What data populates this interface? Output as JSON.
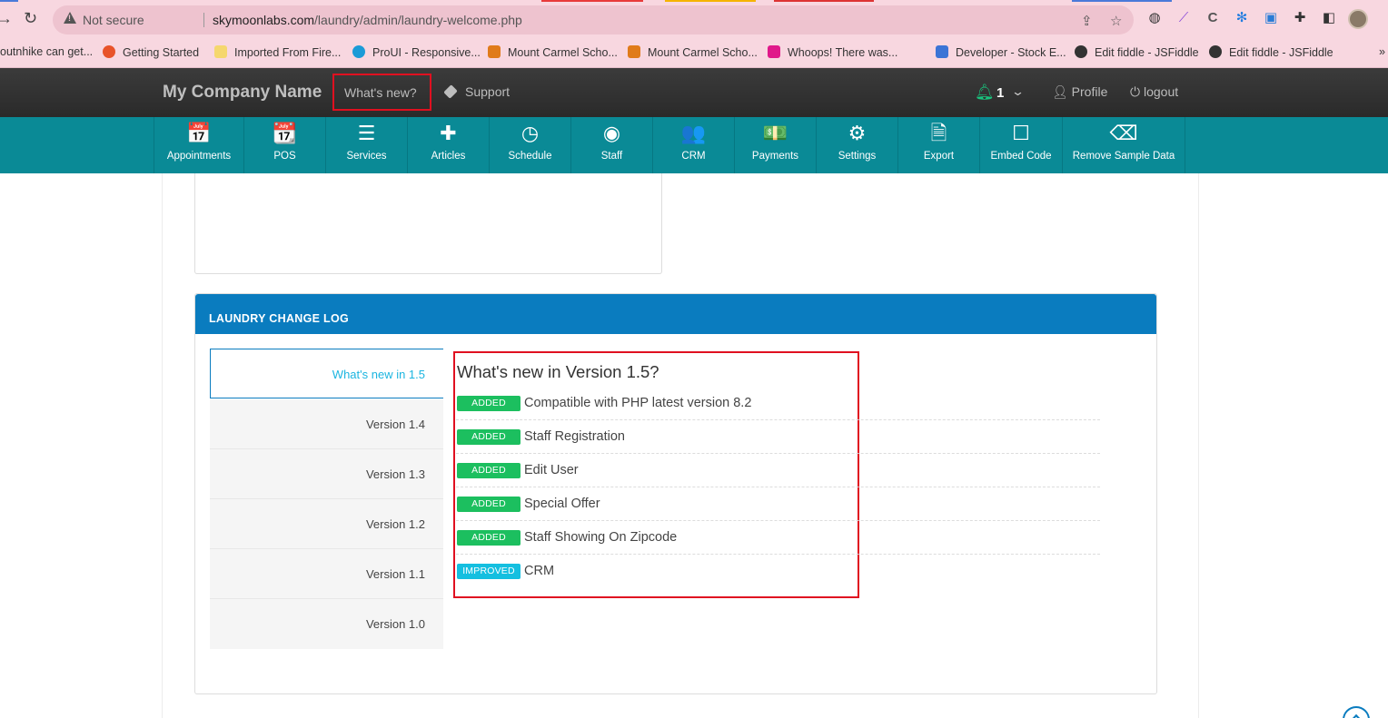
{
  "browser": {
    "security_label": "Not secure",
    "url_host": "skymoonlabs.com",
    "url_path": "/laundry/admin/laundry-welcome.php",
    "bookmarks": [
      {
        "label": "outnhike can get...",
        "color": "#f8d7e0"
      },
      {
        "label": "Getting Started",
        "color": "#e8532a"
      },
      {
        "label": "Imported From Fire...",
        "color": "#f5d76e"
      },
      {
        "label": "ProUI - Responsive...",
        "color": "#1b9bd7"
      },
      {
        "label": "Mount Carmel Scho...",
        "color": "#e07b1a"
      },
      {
        "label": "Mount Carmel Scho...",
        "color": "#e07b1a"
      },
      {
        "label": "Whoops! There was...",
        "color": "#e0188a"
      },
      {
        "label": "Developer - Stock E...",
        "color": "#3b74d6"
      },
      {
        "label": "Edit fiddle - JSFiddle",
        "color": "#333333"
      },
      {
        "label": "Edit fiddle - JSFiddle",
        "color": "#333333"
      }
    ]
  },
  "header": {
    "brand": "My Company Name",
    "whats_new": "What's new?",
    "support": "Support",
    "notification_count": "1",
    "profile": "Profile",
    "logout": "logout",
    "accent_color": "#19c37d"
  },
  "nav": {
    "items": [
      {
        "label": "Appointments",
        "icon": "calendar-icon",
        "glyph": "📅"
      },
      {
        "label": "POS",
        "icon": "calendar-plus-icon",
        "glyph": "📆"
      },
      {
        "label": "Services",
        "icon": "server-icon",
        "glyph": "☰"
      },
      {
        "label": "Articles",
        "icon": "puzzle-icon",
        "glyph": "✚"
      },
      {
        "label": "Schedule",
        "icon": "clock-icon",
        "glyph": "◷"
      },
      {
        "label": "Staff",
        "icon": "user-circle-icon",
        "glyph": "◉"
      },
      {
        "label": "CRM",
        "icon": "users-icon",
        "glyph": "👥"
      },
      {
        "label": "Payments",
        "icon": "money-icon",
        "glyph": "💵"
      },
      {
        "label": "Settings",
        "icon": "gear-icon",
        "glyph": "⚙"
      },
      {
        "label": "Export",
        "icon": "pdf-file-icon",
        "glyph": "🗎"
      },
      {
        "label": "Embed Code",
        "icon": "square-icon",
        "glyph": "☐"
      },
      {
        "label": "Remove Sample Data",
        "icon": "eraser-icon",
        "glyph": "⌫"
      }
    ],
    "color": "#0a8a96"
  },
  "changelog": {
    "title": "LAUNDRY CHANGE LOG",
    "header_color": "#0a7cbf",
    "versions": [
      {
        "label": "What's new in 1.5",
        "active": true
      },
      {
        "label": "Version 1.4",
        "active": false
      },
      {
        "label": "Version 1.3",
        "active": false
      },
      {
        "label": "Version 1.2",
        "active": false
      },
      {
        "label": "Version 1.1",
        "active": false
      },
      {
        "label": "Version 1.0",
        "active": false
      }
    ],
    "content_title": "What's new in Version 1.5?",
    "entries": [
      {
        "badge": "ADDED",
        "badge_color": "#1cbf5f",
        "text": "Compatible with PHP latest version 8.2"
      },
      {
        "badge": "ADDED",
        "badge_color": "#1cbf5f",
        "text": "Staff Registration"
      },
      {
        "badge": "ADDED",
        "badge_color": "#1cbf5f",
        "text": "Edit User"
      },
      {
        "badge": "ADDED",
        "badge_color": "#1cbf5f",
        "text": "Special Offer"
      },
      {
        "badge": "ADDED",
        "badge_color": "#1cbf5f",
        "text": "Staff Showing On Zipcode"
      },
      {
        "badge": "IMPROVED",
        "badge_color": "#14bfe0",
        "text": "CRM"
      }
    ]
  }
}
